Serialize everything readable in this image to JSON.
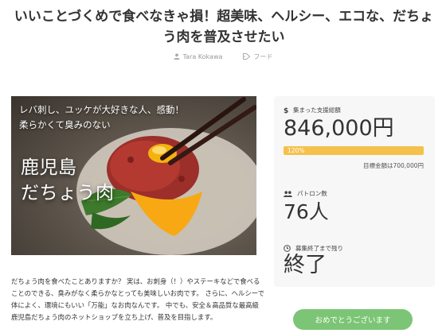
{
  "project": {
    "title": "いいことづくめで食べなきゃ損！超美味、ヘルシー、エコな、だちょう肉を普及させたい",
    "author": "Tara Kokawa",
    "category": "フード"
  },
  "hero": {
    "caption_line1": "レバ刺し、ユッケが大好きな人、感動！",
    "caption_line2": "柔らかくて臭みのない",
    "headline_line1": "鹿児島",
    "headline_line2": "だちょう肉"
  },
  "story": {
    "text": "だちょう肉を食べたことありますか？ 実は、お刺身（！）やステーキなどで食べることのできる、臭みがなく柔らかなとっても美味しいお肉です。 さらに、ヘルシーで体によく、環境にもいい「万能」なお肉なんです。 中でも、安全＆高品質な最高級鹿児島だちょう肉のネットショップを立ち上げ、普及を目指します。"
  },
  "stats": {
    "raised_label": "集まった支援総額",
    "raised_amount": "846,000円",
    "progress_label": "120%",
    "progress_fraction": 1.0,
    "goal_text": "目標金額は700,000円",
    "backers_label": "パトロン数",
    "backers_value": "76人",
    "remaining_label": "募集終了まで残り",
    "remaining_value": "終了"
  },
  "cta": {
    "label": "おめでとうございます"
  },
  "colors": {
    "progress": "#f5c14b",
    "cta": "#7cc576",
    "panel_bg": "#f7f7f7"
  },
  "icons": [
    "user-icon",
    "tag-icon",
    "dollar-icon",
    "group-icon",
    "clock-icon"
  ]
}
